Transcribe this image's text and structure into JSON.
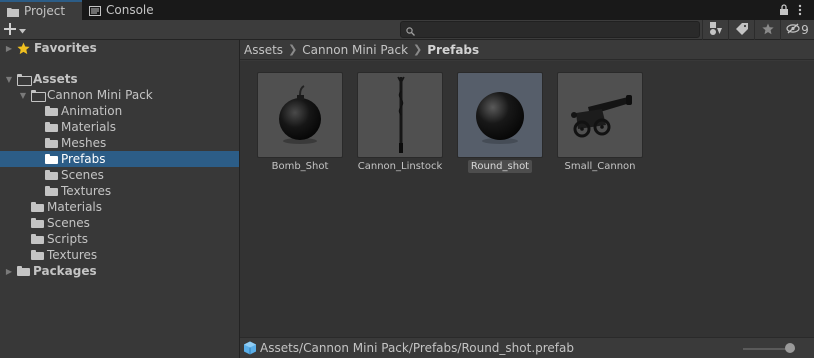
{
  "tabs": [
    {
      "label": "Project",
      "icon": "folder-icon",
      "active": true
    },
    {
      "label": "Console",
      "icon": "console-icon",
      "active": false
    }
  ],
  "toolbar": {
    "create_icon": "plus-icon",
    "search_placeholder": "",
    "hidden_count": "9"
  },
  "tree": {
    "favorites": "Favorites",
    "assets": "Assets",
    "cannon_pack": "Cannon Mini Pack",
    "animation": "Animation",
    "materials_sub": "Materials",
    "meshes": "Meshes",
    "prefabs": "Prefabs",
    "scenes_sub": "Scenes",
    "textures_sub": "Textures",
    "materials": "Materials",
    "scenes": "Scenes",
    "scripts": "Scripts",
    "textures": "Textures",
    "packages": "Packages"
  },
  "breadcrumb": [
    "Assets",
    "Cannon Mini Pack",
    "Prefabs"
  ],
  "assets": [
    {
      "label": "Bomb_Shot",
      "selected": false
    },
    {
      "label": "Cannon_Linstock",
      "selected": false
    },
    {
      "label": "Round_shot",
      "selected": true
    },
    {
      "label": "Small_Cannon",
      "selected": false
    }
  ],
  "status": {
    "path": "Assets/Cannon Mini Pack/Prefabs/Round_shot.prefab"
  },
  "colors": {
    "selection": "#2c5d87",
    "background": "#383838",
    "favorite_star": "#f0c020"
  }
}
